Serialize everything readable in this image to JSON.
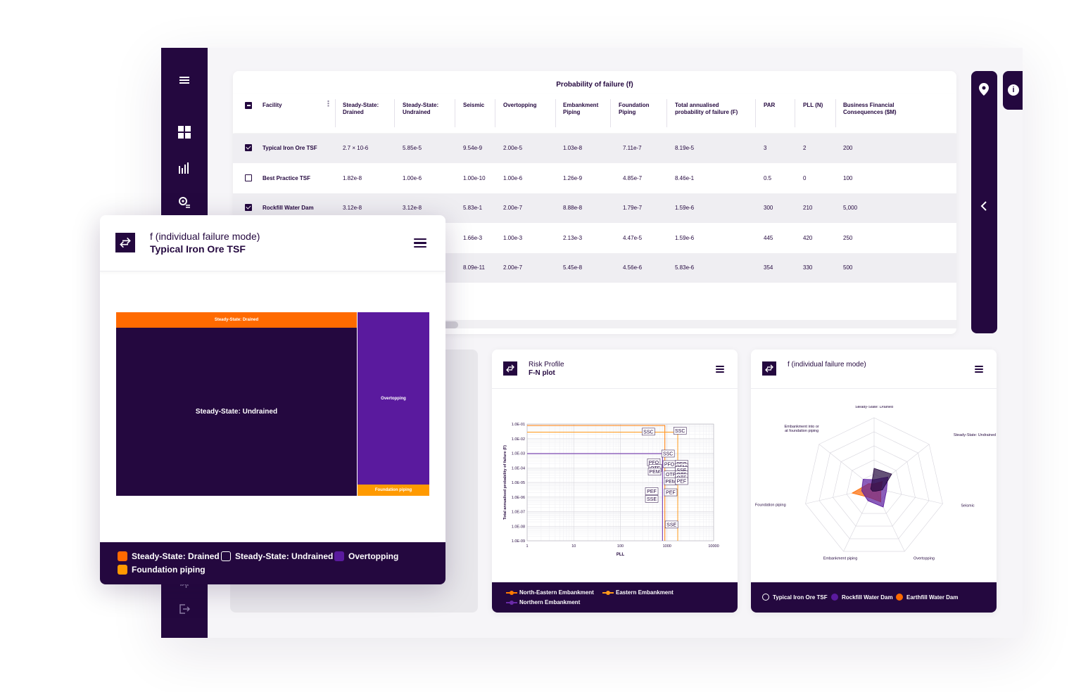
{
  "sidebar": {
    "icons": [
      "menu-icon",
      "dashboard-icon",
      "bar-chart-icon",
      "settings-location-icon",
      "fingerprint-icon",
      "logout-icon"
    ]
  },
  "table": {
    "title": "Probability of failure (f)",
    "headers": {
      "facility": "Facility",
      "ssd": [
        "Steady-State:",
        "Drained"
      ],
      "ssu": [
        "Steady-State:",
        "Undrained"
      ],
      "seismic": "Seismic",
      "overtopping": "Overtopping",
      "emb": [
        "Embankment",
        "Piping"
      ],
      "found": [
        "Foundation",
        "Piping"
      ],
      "total": [
        "Total annualised",
        "probability of failure (F)"
      ],
      "par": "PAR",
      "pll": "PLL (N)",
      "bfc": [
        "Business Financial",
        "Consequences ($M)"
      ]
    },
    "rows": [
      {
        "checked": true,
        "facility": "Typical Iron Ore TSF",
        "ssd": "2.7 × 10-6",
        "ssu": "5.85e-5",
        "seismic": "9.54e-9",
        "overtopping": "2.00e-5",
        "emb": "1.03e-8",
        "found": "7.11e-7",
        "total": "8.19e-5",
        "par": "3",
        "pll": "2",
        "bfc": "200"
      },
      {
        "checked": false,
        "facility": "Best Practice TSF",
        "ssd": "1.82e-8",
        "ssu": "1.00e-6",
        "seismic": "1.00e-10",
        "overtopping": "1.00e-6",
        "emb": "1.26e-9",
        "found": "4.85e-7",
        "total": "8.46e-1",
        "par": "0.5",
        "pll": "0",
        "bfc": "100"
      },
      {
        "checked": true,
        "facility": "Rockfill Water Dam",
        "ssd": "3.12e-8",
        "ssu": "3.12e-8",
        "seismic": "5.83e-1",
        "overtopping": "2.00e-7",
        "emb": "8.88e-8",
        "found": "1.79e-7",
        "total": "1.59e-6",
        "par": "300",
        "pll": "210",
        "bfc": "5,000"
      },
      {
        "checked": false,
        "facility": "",
        "ssd": "",
        "ssu": "",
        "seismic": "1.66e-3",
        "overtopping": "1.00e-3",
        "emb": "2.13e-3",
        "found": "4.47e-5",
        "total": "1.59e-6",
        "par": "445",
        "pll": "420",
        "bfc": "250"
      },
      {
        "checked": false,
        "facility": "",
        "ssd": "",
        "ssu": "",
        "seismic": "8.09e-11",
        "overtopping": "2.00e-7",
        "emb": "5.45e-8",
        "found": "4.56e-6",
        "total": "5.83e-6",
        "par": "354",
        "pll": "330",
        "bfc": "500"
      }
    ]
  },
  "big_card": {
    "subtitle": "f (individual failure mode)",
    "title": "Typical Iron Ore TSF",
    "legend": [
      {
        "label": "Steady-State: Drained",
        "color": "#ff6a00",
        "outline": false
      },
      {
        "label": "Steady-State: Undrained",
        "color": "#24083f",
        "outline": true
      },
      {
        "label": "Overtopping",
        "color": "#5a1a9e",
        "outline": false
      },
      {
        "label": "Foundation piping",
        "color": "#ff9a00",
        "outline": false
      }
    ],
    "treemap": {
      "top_label": "Steady-State: Drained",
      "main_label": "Steady-State: Undrained",
      "right_label": "Overtopping",
      "bottom_label": "Foundation piping"
    }
  },
  "fn_card": {
    "subtitle": "Risk Profile",
    "title": "F-N plot",
    "legend": [
      {
        "label": "North-Eastern Embankment",
        "color": "#ff7a00"
      },
      {
        "label": "Eastern Embankment",
        "color": "#ff9a1a"
      },
      {
        "label": "Northern Embankment",
        "color": "#6a2aa8"
      }
    ]
  },
  "chart_data": [
    {
      "type": "scatter",
      "title": "",
      "xlabel": "PLL",
      "ylabel": "Total annualised probability of failure (F)",
      "x_scale": "log",
      "y_scale": "log",
      "xlim": [
        1,
        10000
      ],
      "ylim": [
        1e-09,
        0.1
      ],
      "x_ticks": [
        "1",
        "10",
        "100",
        "1000",
        "10000"
      ],
      "y_ticks": [
        "1.0E-01",
        "1.0E-02",
        "1.0E-03",
        "1.0E-04",
        "1.0E-05",
        "1.0E-06",
        "1.0E-07",
        "1.0E-08",
        "1.0E-09"
      ],
      "point_labels": [
        {
          "text": "SSC",
          "x": 400,
          "y": 0.03
        },
        {
          "text": "SSC",
          "x": 1900,
          "y": 0.035
        },
        {
          "text": "SSC",
          "x": 1050,
          "y": 0.00095
        },
        {
          "text": "PFO",
          "x": 520,
          "y": 0.00024
        },
        {
          "text": "PFO",
          "x": 1120,
          "y": 0.00018
        },
        {
          "text": "PFO",
          "x": 2050,
          "y": 0.00019
        },
        {
          "text": "OTF",
          "x": 560,
          "y": 0.0001
        },
        {
          "text": "PEM",
          "x": 2050,
          "y": 0.000115
        },
        {
          "text": "PEM",
          "x": 540,
          "y": 5.5e-05
        },
        {
          "text": "SSE",
          "x": 2050,
          "y": 7e-05
        },
        {
          "text": "OTF",
          "x": 1200,
          "y": 3.5e-05
        },
        {
          "text": "OTF",
          "x": 2050,
          "y": 3.5e-05
        },
        {
          "text": "OTF",
          "x": 2050,
          "y": 2.2e-05
        },
        {
          "text": "PEM",
          "x": 1200,
          "y": 1.2e-05
        },
        {
          "text": "PEF",
          "x": 2050,
          "y": 1.25e-05
        },
        {
          "text": "PEF",
          "x": 470,
          "y": 2.5e-06
        },
        {
          "text": "PEF",
          "x": 1200,
          "y": 2.1e-06
        },
        {
          "text": "SSE",
          "x": 470,
          "y": 7.5e-07
        },
        {
          "text": "SSE",
          "x": 1250,
          "y": 1.3e-08
        }
      ],
      "series": [
        {
          "name": "North-Eastern Embankment",
          "color": "#ff7a00",
          "step": [
            [
              1,
              0.08
            ],
            [
              900,
              0.08
            ],
            [
              900,
              1e-09
            ]
          ]
        },
        {
          "name": "Eastern Embankment",
          "color": "#ff9a1a",
          "step": [
            [
              1,
              0.028
            ],
            [
              1700,
              0.028
            ],
            [
              1700,
              1e-09
            ]
          ]
        },
        {
          "name": "Northern Embankment",
          "color": "#6a2aa8",
          "step": [
            [
              1,
              0.00095
            ],
            [
              800,
              0.00095
            ],
            [
              800,
              1e-09
            ]
          ]
        }
      ],
      "grid": true
    },
    {
      "type": "radar",
      "title": "",
      "axes": [
        "Steady-State: Drained",
        "Steady-State: Undrained",
        "Seismic",
        "Overtopping",
        "Embankment piping",
        "Foundation piping",
        "Embankment into or at foundation piping"
      ],
      "series": [
        {
          "name": "Typical Iron Ore TSF",
          "color": "#24083f",
          "values": [
            0.28,
            0.32,
            0.12,
            0.05,
            0.05,
            0.05,
            0.05
          ]
        },
        {
          "name": "Rockfill Water Dam",
          "color": "#5a1a9e",
          "values": [
            0.12,
            0.25,
            0.18,
            0.3,
            0.2,
            0.18,
            0.2
          ]
        },
        {
          "name": "Earthfill Water Dam",
          "color": "#ff6a00",
          "values": [
            0.06,
            0.15,
            0.1,
            0.22,
            0.15,
            0.32,
            0.1
          ]
        }
      ]
    },
    {
      "type": "treemap",
      "title": "",
      "categories": [
        "Steady-State: Undrained",
        "Overtopping",
        "Steady-State: Drained",
        "Foundation piping"
      ],
      "values": [
        58.5,
        20,
        2.7,
        0.7
      ]
    }
  ],
  "radar_card": {
    "subtitle": "f (individual failure mode)",
    "legend": [
      {
        "label": "Typical Iron Ore TSF",
        "color": "#24083f",
        "outline": true
      },
      {
        "label": "Rockfill Water Dam",
        "color": "#5a1a9e",
        "outline": false
      },
      {
        "label": "Earthfill Water Dam",
        "color": "#ff6a00",
        "outline": false
      }
    ]
  }
}
